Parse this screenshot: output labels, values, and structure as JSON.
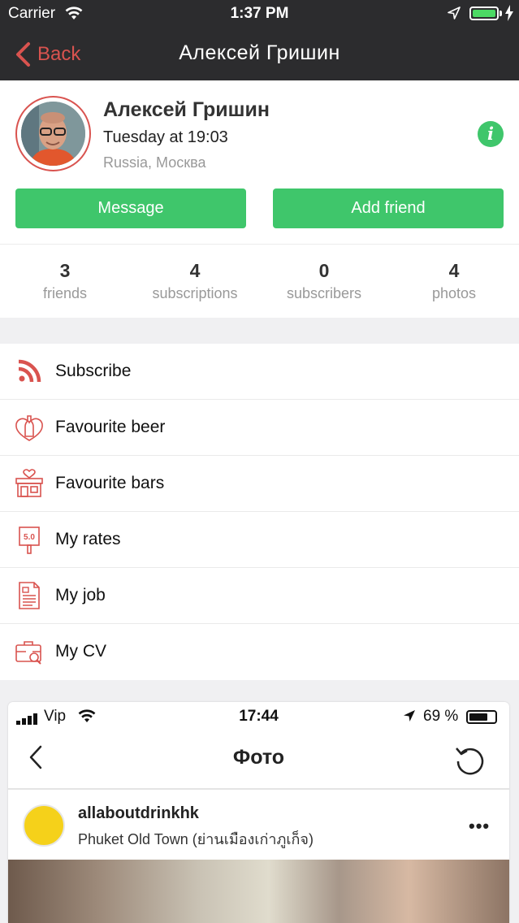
{
  "status_bar": {
    "carrier": "Carrier",
    "time": "1:37 PM"
  },
  "nav": {
    "back_label": "Back",
    "title": "Алексей Гришин"
  },
  "profile": {
    "name": "Алексей Гришин",
    "last_seen": "Tuesday at 19:03",
    "location": "Russia, Москва",
    "info_icon": "i",
    "message_button": "Message",
    "add_friend_button": "Add friend"
  },
  "stats": [
    {
      "value": "3",
      "label": "friends"
    },
    {
      "value": "4",
      "label": "subscriptions"
    },
    {
      "value": "0",
      "label": "subscribers"
    },
    {
      "value": "4",
      "label": "photos"
    }
  ],
  "menu": {
    "items": [
      {
        "label": "Subscribe",
        "icon": "rss-icon"
      },
      {
        "label": "Favourite beer",
        "icon": "beer-heart-icon"
      },
      {
        "label": "Favourite bars",
        "icon": "bar-shop-icon"
      },
      {
        "label": "My rates",
        "icon": "rating-sign-icon"
      },
      {
        "label": "My job",
        "icon": "document-icon"
      },
      {
        "label": "My CV",
        "icon": "briefcase-search-icon"
      }
    ],
    "rate_badge": "5.0"
  },
  "photo_preview": {
    "status_carrier": "Vip",
    "status_time": "17:44",
    "status_battery": "69 %",
    "title": "Фото",
    "post_user": "allaboutdrinkhk",
    "post_location": "Phuket Old Town (ย่านเมืองเก่าภูเก็จ)",
    "more": "•••"
  },
  "colors": {
    "accent_red": "#d9534f",
    "green": "#3fc66b",
    "bar_dark": "#2c2c2e"
  }
}
